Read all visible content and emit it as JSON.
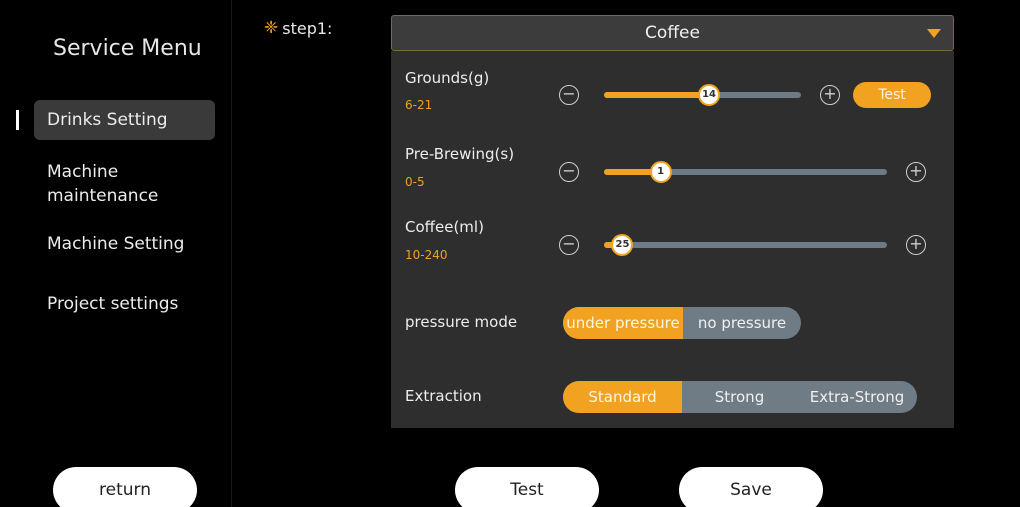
{
  "sidebar": {
    "title": "Service Menu",
    "items": [
      {
        "label": "Drinks Setting"
      },
      {
        "label": "Machine\nmaintenance"
      },
      {
        "label": "Machine Setting"
      },
      {
        "label": "Project settings"
      }
    ],
    "return_label": "return"
  },
  "step": {
    "label": "step1:",
    "icon": "snowflake-icon",
    "drink_selected": "Coffee"
  },
  "sliders": [
    {
      "label": "Grounds(g)",
      "range": "6-21",
      "min": 6,
      "max": 21,
      "value": 14,
      "value_text": "14"
    },
    {
      "label": "Pre-Brewing(s)",
      "range": "0-5",
      "min": 0,
      "max": 5,
      "value": 1,
      "value_text": "1"
    },
    {
      "label": "Coffee(ml)",
      "range": "10-240",
      "min": 10,
      "max": 240,
      "value": 25,
      "value_text": "25"
    }
  ],
  "grounds_test_label": "Test",
  "pressure_mode": {
    "label": "pressure mode",
    "options": [
      "under pressure",
      "no pressure"
    ],
    "selected": "under pressure"
  },
  "extraction": {
    "label": "Extraction",
    "options": [
      "Standard",
      "Strong",
      "Extra-Strong"
    ],
    "selected": "Standard"
  },
  "footer": {
    "test_label": "Test",
    "save_label": "Save"
  },
  "colors": {
    "accent": "#f2a221",
    "track": "#6c7b85",
    "panel": "#2e2e2e"
  }
}
